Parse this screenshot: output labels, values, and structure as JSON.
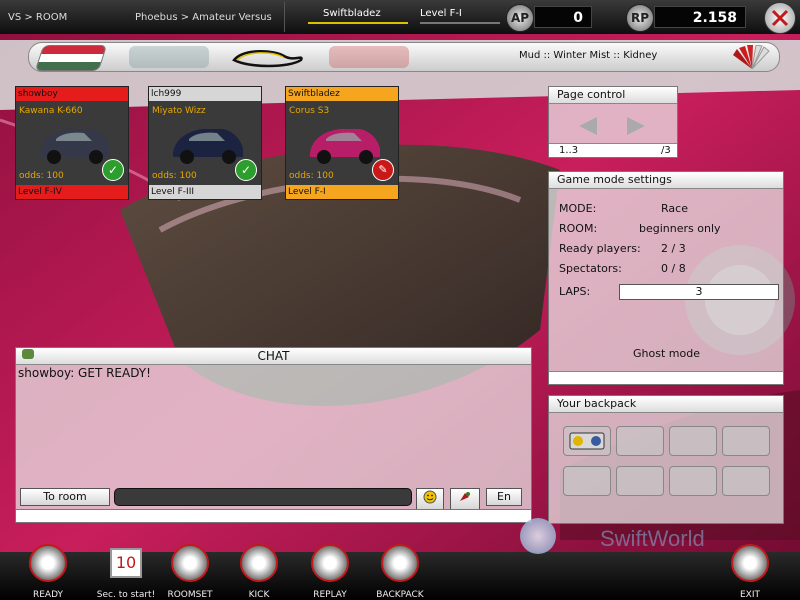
{
  "header": {
    "breadcrumb": "VS > ROOM",
    "room_name": "Phoebus > Amateur Versus",
    "player": "Swiftbladez",
    "player_level": "Level F-I",
    "ap_label": "AP",
    "ap_value": "0",
    "rp_label": "RP",
    "rp_value": "2.158"
  },
  "track": {
    "name": "Mud :: Winter Mist :: Kidney"
  },
  "players": [
    {
      "name": "showboy",
      "car": "Kawana K-660",
      "odds": "odds: 100",
      "level": "Level F-IV",
      "status": "ready",
      "car_color": "#343848",
      "header_color": "#e41c1c"
    },
    {
      "name": "lch999",
      "car": "Miyato Wizz",
      "odds": "odds: 100",
      "level": "Level F-III",
      "status": "ready",
      "car_color": "#1c2340",
      "header_color": "#d6d6d6"
    },
    {
      "name": "Swiftbladez",
      "car": "Corus S3",
      "odds": "odds: 100",
      "level": "Level F-I",
      "status": "not-ready",
      "car_color": "#b81e68",
      "header_color": "#f6a51f"
    }
  ],
  "page_control": {
    "title": "Page control",
    "range": "1..3",
    "total": "/3"
  },
  "game_mode": {
    "title": "Game mode settings",
    "rows": [
      {
        "label": "MODE:",
        "value": "Race"
      },
      {
        "label": "ROOM:",
        "value": "beginners only"
      },
      {
        "label": "Ready players:",
        "value": "2 / 3"
      },
      {
        "label": "Spectators:",
        "value": "0 / 8"
      }
    ],
    "laps_label": "LAPS:",
    "laps_value": "3",
    "ghost_mode": "Ghost mode"
  },
  "chat": {
    "title": "CHAT",
    "messages": [
      "showboy: GET READY!"
    ],
    "to_room_label": "To room",
    "language_label": "En"
  },
  "backpack": {
    "title": "Your backpack",
    "slots": 8
  },
  "bottom": {
    "ready_label": "READY",
    "countdown": "10",
    "countdown_label": "Sec. to start!",
    "roomset_label": "ROOMSET",
    "kick_label": "KICK",
    "replay_label": "REPLAY",
    "backpack_label": "BACKPACK",
    "exit_label": "EXIT"
  },
  "brand": {
    "text": "SwiftWorld"
  },
  "colors": {
    "accent_red": "#e41c1c",
    "accent_orange": "#f6a51f",
    "car_paint": "#b4164e",
    "ok_green": "#2d9e2d"
  }
}
